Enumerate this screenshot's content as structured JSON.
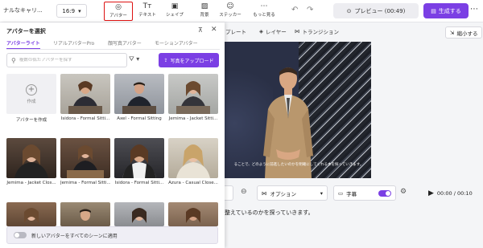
{
  "header": {
    "project_name": "ナルなキャリ...",
    "ratio": "16:9",
    "tools": [
      {
        "label": "アバター",
        "icon": "avatar-icon"
      },
      {
        "label": "テキスト",
        "icon": "text-icon"
      },
      {
        "label": "シェイプ",
        "icon": "shape-icon"
      },
      {
        "label": "背景",
        "icon": "background-icon"
      },
      {
        "label": "ステッカー",
        "icon": "sticker-icon"
      },
      {
        "label": "もっと見る",
        "icon": "more-icon"
      }
    ],
    "preview_label": "プレビュー (00:49)",
    "generate_label": "生成する"
  },
  "sub_toolbar": {
    "template_label": "プレート",
    "layer_label": "レイヤー",
    "transition_label": "トランジション",
    "shrink_label": "縮小する"
  },
  "canvas": {
    "subtitle": "ることで、どのように前進したいのかを明確にしてくれる本を探っていきます。"
  },
  "controls": {
    "option_label": "オプション",
    "caption_label": "字幕",
    "time": "00:00 / 00:10"
  },
  "script_text": "整えているのかを探っていきます。",
  "panel": {
    "title": "アバターを選択",
    "tabs": [
      "アバターライト",
      "リアルアバターPro",
      "顔写真アバター",
      "モーションアバター"
    ],
    "search_placeholder": "複数の似たアバターを探す",
    "upload_label": "写真をアップロード",
    "create_label": "作成",
    "create_caption": "アバターを作成",
    "avatars": [
      "Isidora - Formal Sitti...",
      "Axel - Formal Sitting",
      "Jemima - Jacket Sitti...",
      "Jemima - Jacket Clos...",
      "Jemima - Formal Sitti...",
      "Isidora - Formal Sitti...",
      "Azura - Casual Close...",
      "",
      "",
      "",
      ""
    ],
    "apply_label": "新しいアバターをすべてのシーンに適用"
  },
  "colors": {
    "accent": "#7b3fe4",
    "highlight_border": "#dd1111"
  }
}
